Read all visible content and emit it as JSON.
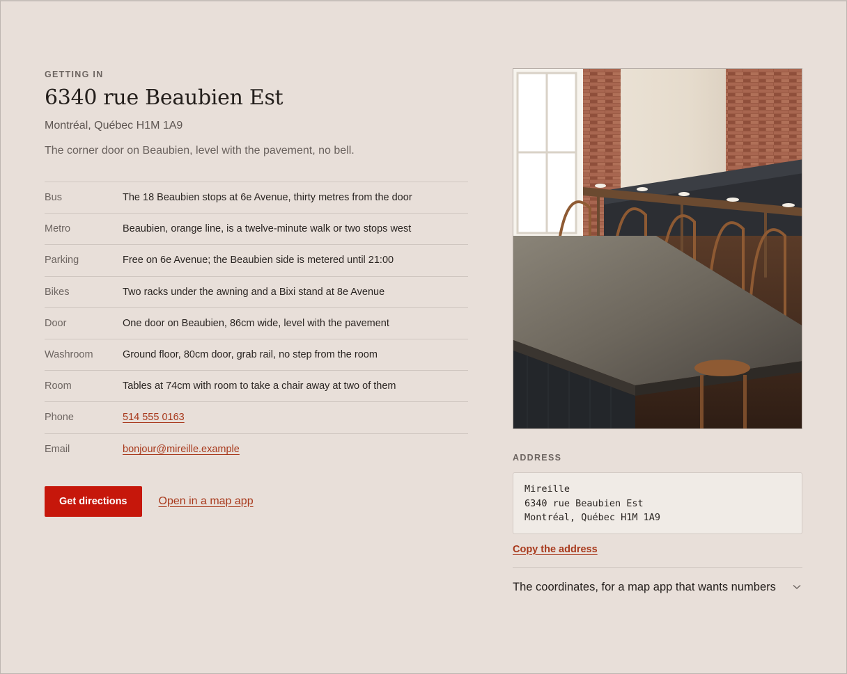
{
  "getting_in": {
    "eyebrow": "GETTING IN",
    "title": "6340 rue Beaubien Est",
    "subtitle": "Montréal, Québec H1M 1A9",
    "note": "The corner door on Beaubien, level with the pavement, no bell."
  },
  "info": [
    {
      "label": "Bus",
      "value": "The 18 Beaubien stops at 6e Avenue, thirty metres from the door"
    },
    {
      "label": "Metro",
      "value": "Beaubien, orange line, is a twelve-minute walk or two stops west"
    },
    {
      "label": "Parking",
      "value": "Free on 6e Avenue; the Beaubien side is metered until 21:00"
    },
    {
      "label": "Bikes",
      "value": "Two racks under the awning and a Bixi stand at 8e Avenue"
    },
    {
      "label": "Door",
      "value": "One door on Beaubien, 86cm wide, level with the pavement"
    },
    {
      "label": "Washroom",
      "value": "Ground floor, 80cm door, grab rail, no step from the room"
    },
    {
      "label": "Room",
      "value": "Tables at 74cm with room to take a chair away at two of them"
    },
    {
      "label": "Phone",
      "value": "514 555 0163"
    },
    {
      "label": "Email",
      "value": "bonjour@mireille.example"
    }
  ],
  "actions": {
    "directions": "Get directions",
    "map_app": "Open in a map app"
  },
  "address": {
    "label": "ADDRESS",
    "lines": [
      "Mireille",
      "6340 rue Beaubien Est",
      "Montréal, Québec H1M 1A9"
    ],
    "copy": "Copy the address"
  },
  "coordinates": {
    "summary": "The coordinates, for a map app that wants numbers",
    "icon": "chevron-down-icon"
  },
  "colors": {
    "background": "#e8dfd9",
    "accent_button": "#c6170b",
    "link": "#a8391c"
  }
}
